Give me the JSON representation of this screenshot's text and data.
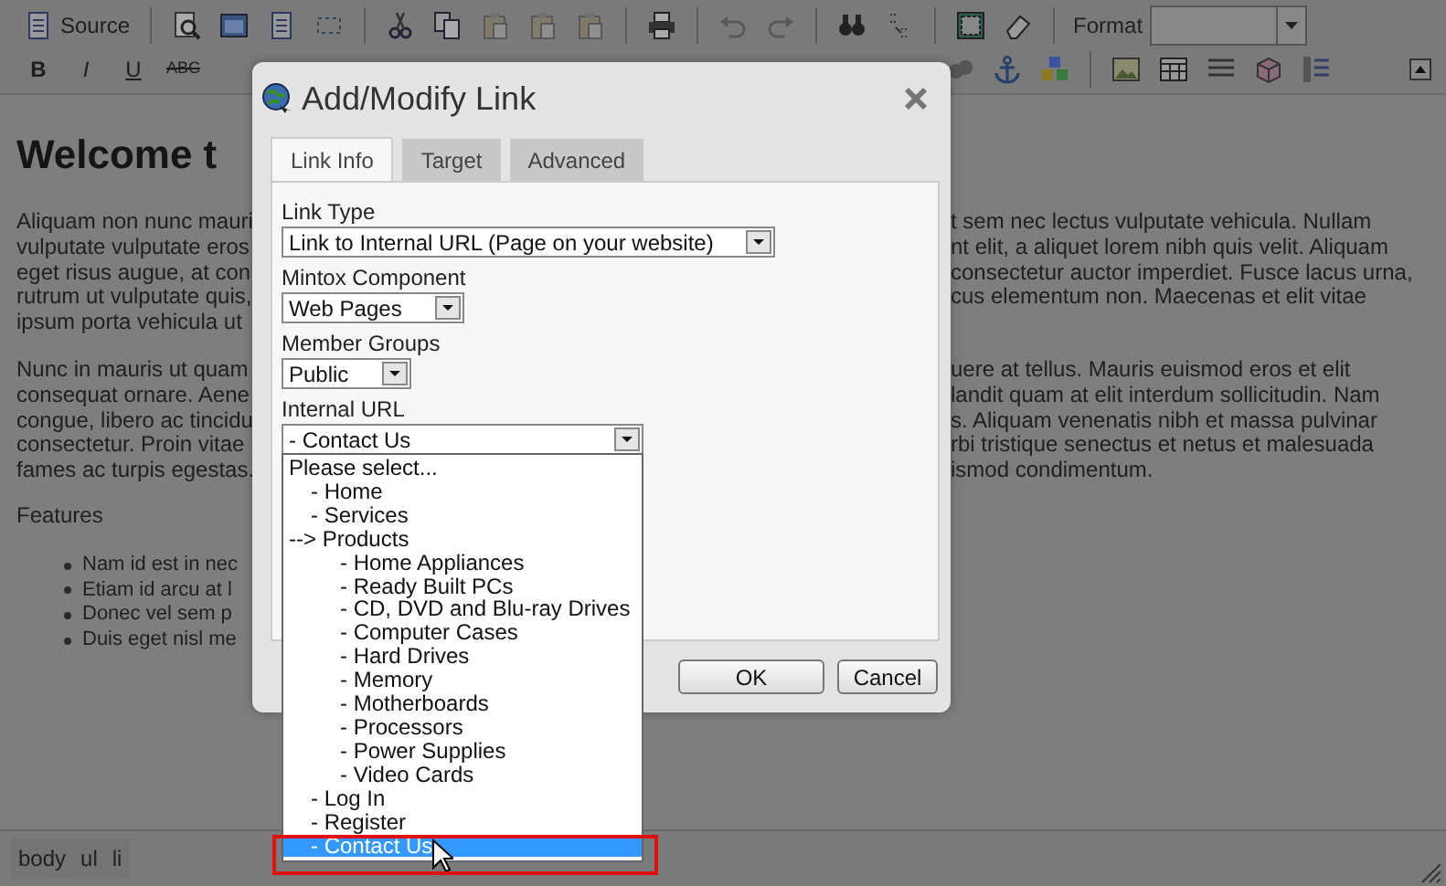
{
  "toolbar": {
    "row_1": [
      {
        "kind": "source",
        "label": "Source",
        "disabled": false
      },
      {
        "kind": "sep"
      },
      {
        "kind": "preview",
        "disabled": false
      },
      {
        "kind": "template",
        "disabled": false
      },
      {
        "kind": "document",
        "disabled": false
      },
      {
        "kind": "showblocks",
        "disabled": false
      },
      {
        "kind": "sep"
      },
      {
        "kind": "cut",
        "disabled": false
      },
      {
        "kind": "copy",
        "disabled": false
      },
      {
        "kind": "paste",
        "disabled": true
      },
      {
        "kind": "paste",
        "disabled": true
      },
      {
        "kind": "paste",
        "disabled": true
      },
      {
        "kind": "sep"
      },
      {
        "kind": "print",
        "disabled": false
      },
      {
        "kind": "sep"
      },
      {
        "kind": "undo",
        "disabled": true
      },
      {
        "kind": "redo",
        "disabled": true
      },
      {
        "kind": "sep"
      },
      {
        "kind": "find",
        "disabled": false
      },
      {
        "kind": "replace",
        "disabled": false
      },
      {
        "kind": "sep"
      },
      {
        "kind": "selectall",
        "disabled": false
      },
      {
        "kind": "eraser",
        "disabled": false
      },
      {
        "kind": "sep"
      },
      {
        "kind": "format",
        "label": "Format"
      },
      {
        "kind": "select"
      }
    ],
    "row_2_left": [
      {
        "kind": "bold",
        "label": "B",
        "disabled": false
      },
      {
        "kind": "italic",
        "label": "I",
        "disabled": false
      },
      {
        "kind": "underline",
        "label": "U",
        "disabled": false
      },
      {
        "kind": "strike",
        "label": "ABC",
        "disabled": false
      }
    ],
    "row_2_right": [
      {
        "kind": "shape"
      },
      {
        "kind": "anchor",
        "disabled": false
      },
      {
        "kind": "cubes",
        "disabled": false
      },
      {
        "kind": "sep"
      },
      {
        "kind": "image",
        "disabled": false
      },
      {
        "kind": "table",
        "disabled": false
      },
      {
        "kind": "hr",
        "disabled": false
      },
      {
        "kind": "box",
        "disabled": false
      },
      {
        "kind": "pagebreak",
        "disabled": false
      }
    ]
  },
  "editor": {
    "heading": "Welcome t",
    "left_paragraphs": [
      [
        "Aliquam non nunc mauri",
        "vulputate vulputate eros",
        "eget risus augue, at con",
        "rutrum ut vulputate quis,",
        "ipsum porta vehicula ut"
      ],
      [
        "Nunc in mauris ut quam",
        "consequat ornare. Aene",
        "congue, libero ac tincidu",
        "consectetur. Proin vitae",
        "fames ac turpis egestas."
      ]
    ],
    "right_paragraphs": [
      [
        "t sem nec lectus vulputate vehicula. Nullam",
        "nt elit, a aliquet lorem nibh quis velit. Aliquam",
        "consectetur auctor imperdiet. Fusce lacus urna,",
        "cus elementum non. Maecenas et elit vitae"
      ],
      [
        "uere at tellus. Mauris euismod eros et elit",
        "landit quam at elit interdum sollicitudin. Nam",
        "s. Aliquam venenatis nibh et massa pulvinar",
        "rbi tristique senectus et netus et malesuada",
        "ismod condimentum."
      ]
    ],
    "features": "Features",
    "bullets": [
      "Nam id est in nec",
      "Etiam id arcu at l",
      "Donec vel sem p",
      "Duis eget nisl me"
    ]
  },
  "status_bar": {
    "path": [
      "body",
      "ul",
      "li"
    ]
  },
  "dialog": {
    "title": "Add/Modify Link",
    "tabs": [
      {
        "label": "Link Info",
        "selected": true
      },
      {
        "label": "Target",
        "selected": false
      },
      {
        "label": "Advanced",
        "selected": false
      }
    ],
    "fields": [
      {
        "label": "Link Type",
        "value": "Link to Internal URL (Page on your website)",
        "expanded": false
      },
      {
        "label": "Mintox Component",
        "value": "Web Pages",
        "expanded": false
      },
      {
        "label": "Member Groups",
        "value": "Public",
        "expanded": false
      },
      {
        "label": "Internal URL",
        "value": "- Contact Us",
        "expanded": true
      }
    ],
    "options": [
      {
        "kind": "placeholder",
        "label": "Please select...",
        "selected": false
      },
      {
        "kind": "page",
        "label": "- Home",
        "selected": false
      },
      {
        "kind": "page",
        "label": "- Services",
        "selected": false
      },
      {
        "kind": "section",
        "label": "--> Products",
        "selected": false,
        "children": [
          {
            "label": "- Home Appliances",
            "selected": false
          },
          {
            "label": "- Ready Built PCs",
            "selected": false
          },
          {
            "label": "- CD, DVD and Blu-ray Drives",
            "selected": false
          },
          {
            "label": "- Computer Cases",
            "selected": false
          },
          {
            "label": "- Hard Drives",
            "selected": false
          },
          {
            "label": "- Memory",
            "selected": false
          },
          {
            "label": "- Motherboards",
            "selected": false
          },
          {
            "label": "- Processors",
            "selected": false
          },
          {
            "label": "- Power Supplies",
            "selected": false
          },
          {
            "label": "- Video Cards",
            "selected": false
          }
        ]
      },
      {
        "kind": "page",
        "label": "- Log In",
        "selected": false
      },
      {
        "kind": "page",
        "label": "- Register",
        "selected": false
      },
      {
        "kind": "page",
        "label": "- Contact Us",
        "selected": true
      }
    ],
    "buttons": [
      "OK",
      "Cancel"
    ]
  }
}
